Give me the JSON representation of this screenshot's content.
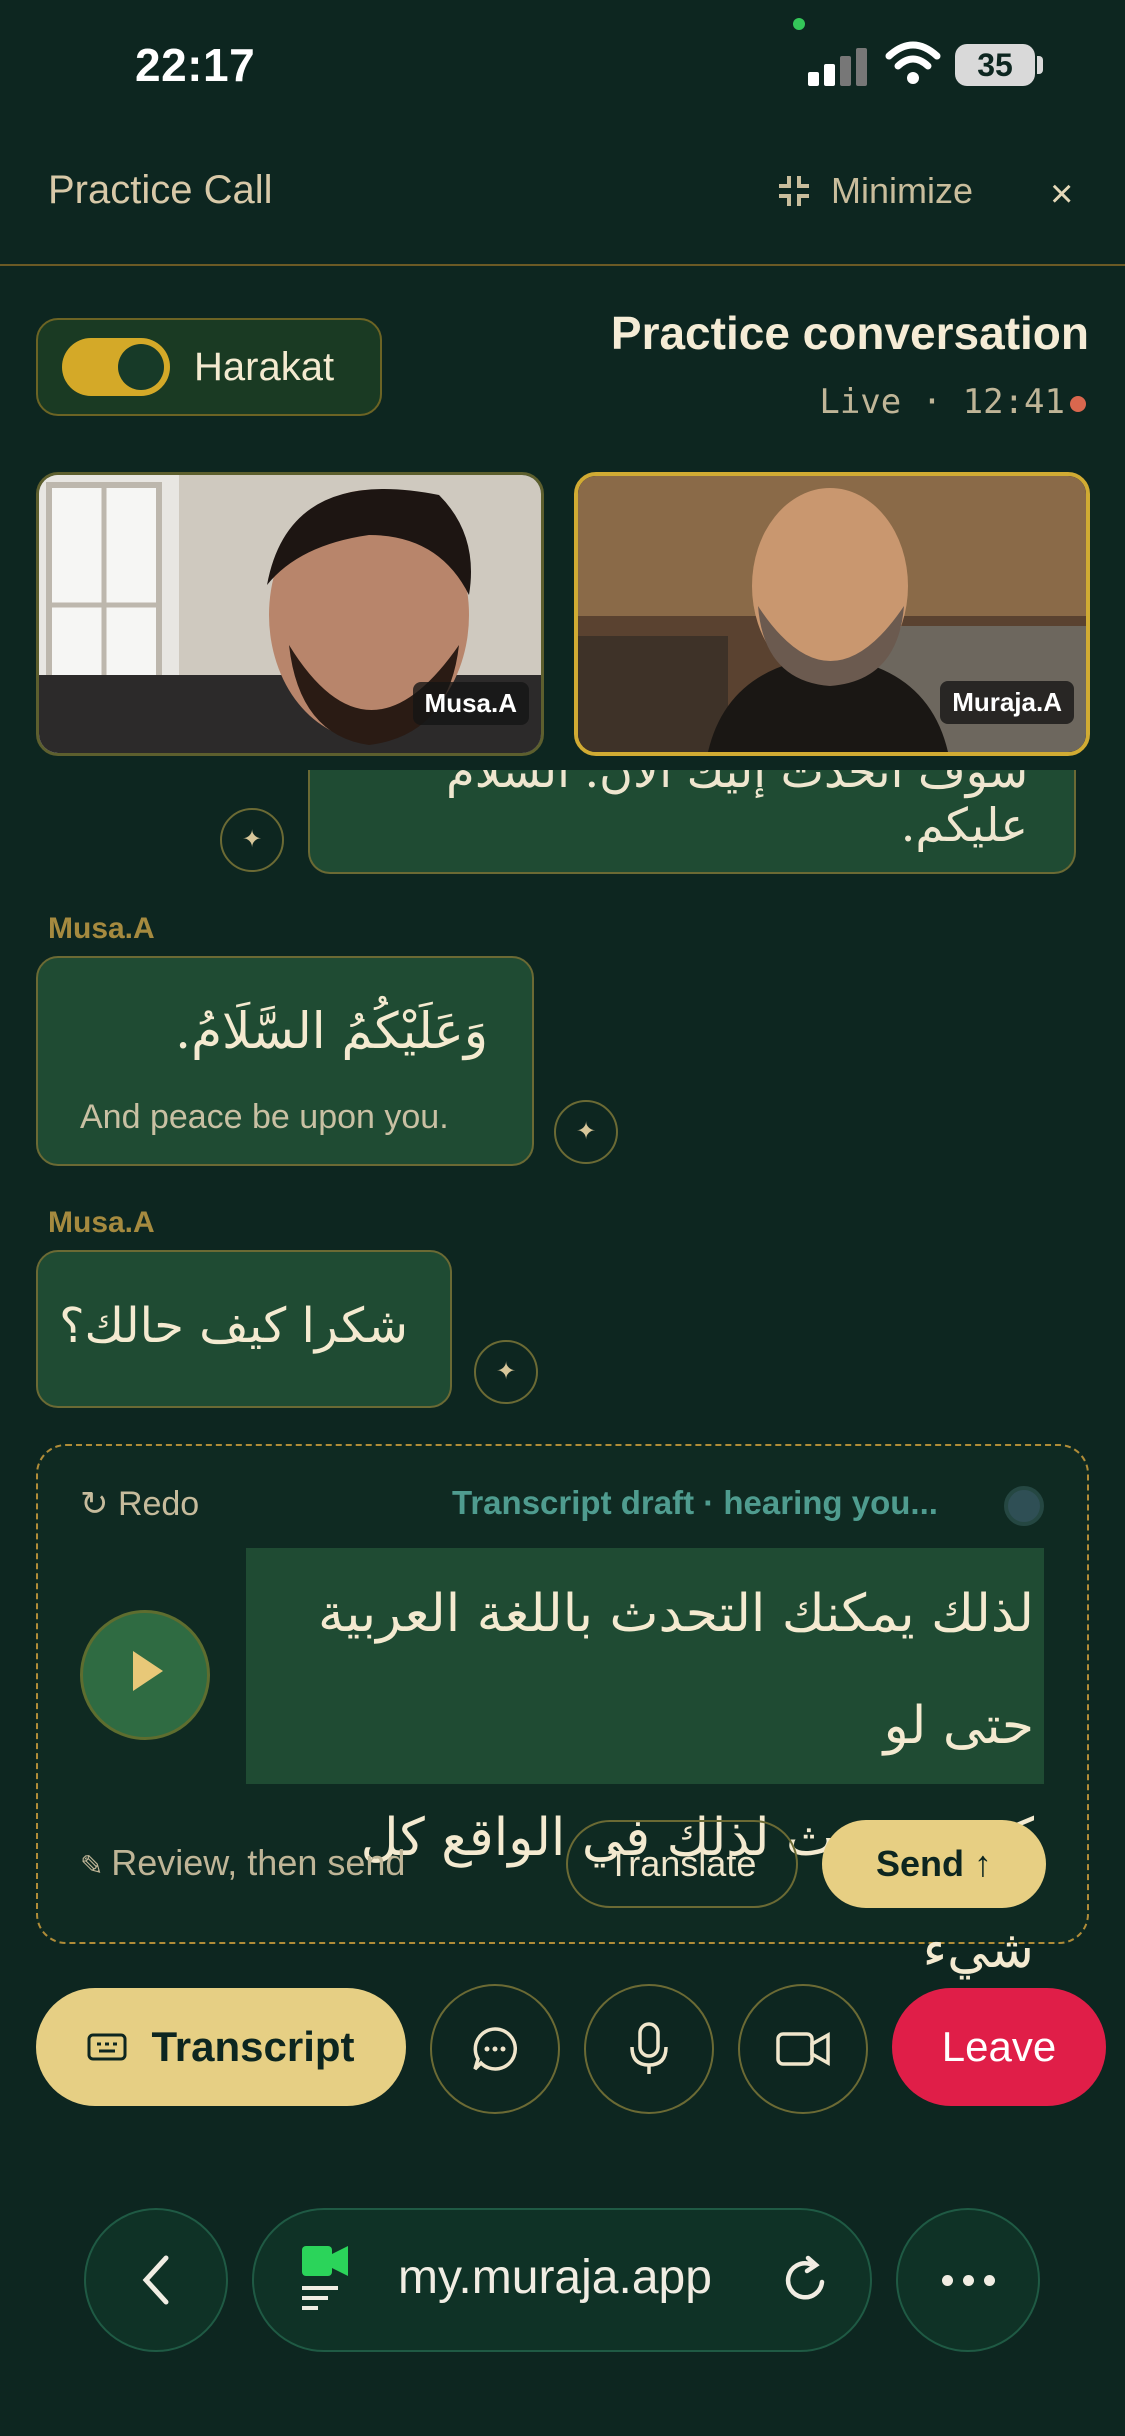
{
  "status_bar": {
    "time": "22:17",
    "battery": "35"
  },
  "header": {
    "title": "Practice Call",
    "minimize_label": "Minimize",
    "close_glyph": "×"
  },
  "harakat": {
    "label": "Harakat",
    "enabled": true
  },
  "conversation": {
    "title": "Practice conversation",
    "live_status": "Live · 12:41"
  },
  "participants": [
    {
      "name": "Musa.A"
    },
    {
      "name": "Muraja.A"
    }
  ],
  "messages": [
    {
      "arabic": "سوف أتحدث إليك الآن. السلام عليكم."
    },
    {
      "sender": "Musa.A",
      "arabic": "وَعَلَيْكُمُ السَّلَامُ.",
      "translation": "And peace be upon you."
    },
    {
      "sender": "Musa.A",
      "arabic": "شكرا كيف حالك؟"
    }
  ],
  "draft": {
    "redo_label": "Redo",
    "status": "Transcript draft · hearing you...",
    "lines": [
      "لذلك يمكنك التحدث باللغة العربية حتى لو",
      "كنت تتحدث لذلك في الواقع كل شيء"
    ],
    "hint": "Review, then send",
    "translate_label": "Translate",
    "send_label": "Send ↑"
  },
  "controls": {
    "transcript_label": "Transcript",
    "leave_label": "Leave"
  },
  "browser": {
    "url": "my.muraja.app"
  },
  "colors": {
    "accent": "#e6cf84",
    "leave": "#e01e48",
    "background": "#0d2620",
    "bubble": "#1f4b33"
  },
  "icons": [
    "minimize-icon",
    "close-icon",
    "sparkle-icon",
    "redo-icon",
    "play-icon",
    "pencil-icon",
    "keyboard-icon",
    "chat-icon",
    "microphone-icon",
    "video-camera-icon",
    "back-chevron-icon",
    "meet-icon",
    "reload-icon",
    "more-icon"
  ]
}
